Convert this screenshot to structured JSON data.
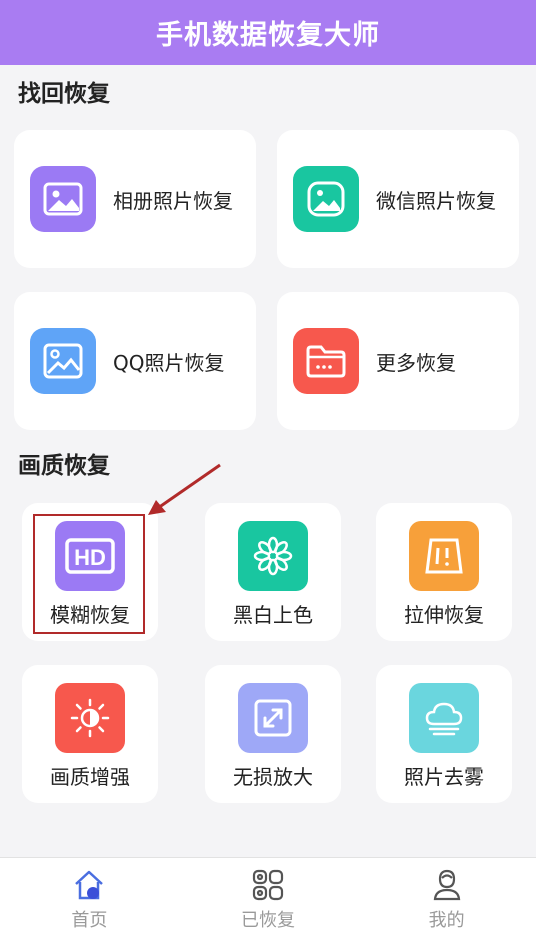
{
  "header": {
    "title": "手机数据恢复大师"
  },
  "sections": {
    "recover_title": "找回恢复",
    "quality_title": "画质恢复"
  },
  "recover_items": [
    {
      "label": "相册照片恢复",
      "icon": "gallery-icon",
      "color": "#9b7af4"
    },
    {
      "label": "微信照片恢复",
      "icon": "wechat-photo-icon",
      "color": "#19c6a0"
    },
    {
      "label": "QQ照片恢复",
      "icon": "qq-photo-icon",
      "color": "#5fa4f7"
    },
    {
      "label": "更多恢复",
      "icon": "folder-icon",
      "color": "#f7584d"
    }
  ],
  "quality_items": [
    {
      "label": "模糊恢复",
      "icon": "hd-icon",
      "color": "#9b7af4"
    },
    {
      "label": "黑白上色",
      "icon": "color-flower-icon",
      "color": "#19c6a0"
    },
    {
      "label": "拉伸恢复",
      "icon": "stretch-icon",
      "color": "#f7a03a"
    },
    {
      "label": "画质增强",
      "icon": "brightness-icon",
      "color": "#f7584d"
    },
    {
      "label": "无损放大",
      "icon": "enlarge-icon",
      "color": "#9ea8f7"
    },
    {
      "label": "照片去雾",
      "icon": "dehaze-icon",
      "color": "#6ad6de"
    }
  ],
  "tabbar": [
    {
      "label": "首页",
      "icon": "home-icon"
    },
    {
      "label": "已恢复",
      "icon": "recovered-icon"
    },
    {
      "label": "我的",
      "icon": "profile-icon"
    }
  ]
}
